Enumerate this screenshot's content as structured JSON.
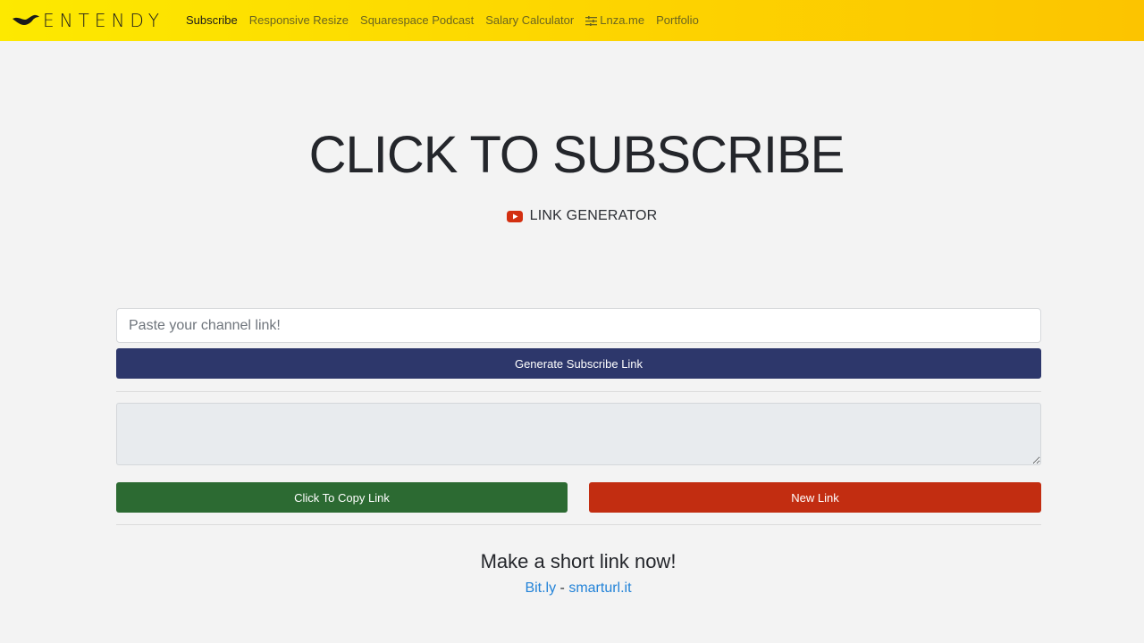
{
  "navbar": {
    "brand": "ENTENDY",
    "links": [
      {
        "label": "Subscribe",
        "active": true
      },
      {
        "label": "Responsive Resize"
      },
      {
        "label": "Squarespace Podcast"
      },
      {
        "label": "Salary Calculator"
      },
      {
        "label": "Lnza.me",
        "icon": "sliders-icon"
      },
      {
        "label": "Portfolio"
      }
    ],
    "colors": {
      "gradient_start": "#fde900",
      "gradient_end": "#fcc400"
    }
  },
  "hero": {
    "title": "CLICK TO SUBSCRIBE",
    "subtitle": "LINK GENERATOR",
    "subtitle_icon": "youtube-icon"
  },
  "form": {
    "input_placeholder": "Paste your channel link!",
    "input_value": "",
    "generate_label": "Generate Subscribe Link",
    "result_value": "",
    "copy_label": "Click To Copy Link",
    "new_label": "New Link"
  },
  "shortlink": {
    "title": "Make a short link now!",
    "link1": "Bit.ly",
    "separator": " - ",
    "link2": "smarturl.it"
  },
  "colors": {
    "generate_button": "#2d376b",
    "copy_button": "#2c6a32",
    "new_button": "#c22d11",
    "link": "#2383d8",
    "youtube_red": "#d32f10"
  }
}
